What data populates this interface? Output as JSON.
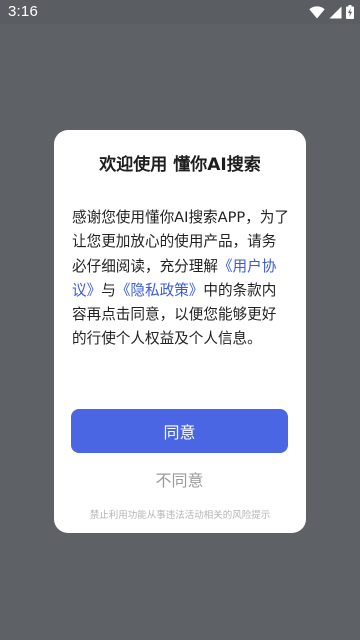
{
  "status_bar": {
    "time": "3:16",
    "icons": [
      "wifi-icon",
      "cellular-signal-icon",
      "battery-charging-icon"
    ]
  },
  "dialog": {
    "title": "欢迎使用 懂你AI搜索",
    "body": {
      "intro": "感谢您使用懂你AI搜索APP，为了让您更加放心的使用产品，请务必仔细阅读，充分理解",
      "user_agreement_link": "《用户协议》",
      "conjunction": "与",
      "privacy_policy_link": "《隐私政策》",
      "outro": "中的条款内容再点击同意，以便您能够更好的行使个人权益及个人信息。"
    },
    "agree_label": "同意",
    "disagree_label": "不同意",
    "footer_notice": "禁止利用功能从事违法活动相关的风险提示"
  },
  "colors": {
    "overlay": "#5e6165",
    "primary": "#4a66e3",
    "link": "#3b5bd6",
    "muted_text": "#9a9a9a"
  }
}
